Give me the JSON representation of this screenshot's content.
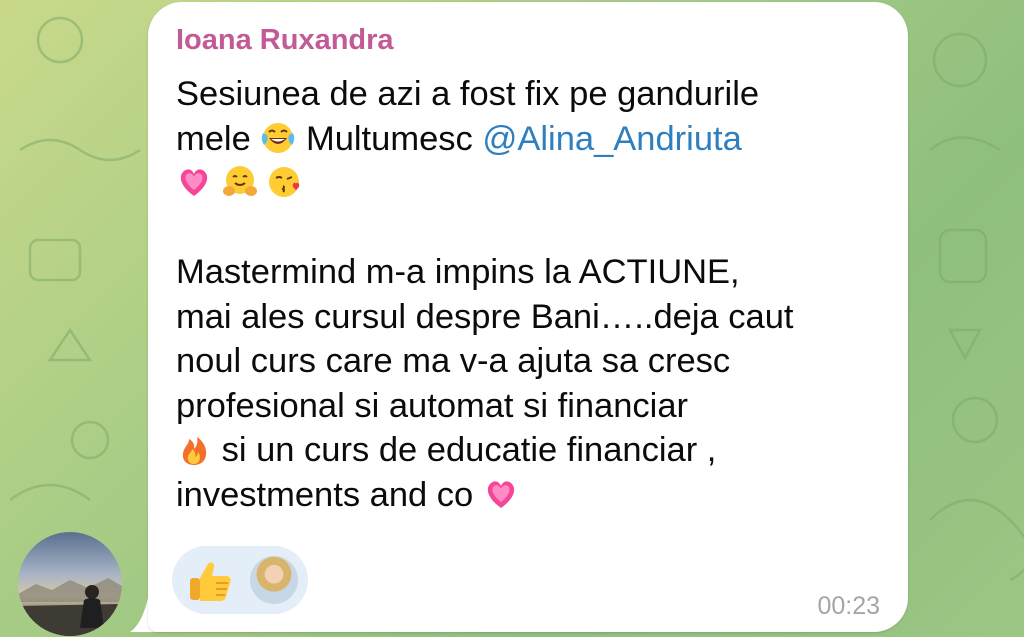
{
  "chat": {
    "sender_name": "Ioana Ruxandra",
    "message": {
      "line1": "Sesiunea de azi a fost fix pe gandurile",
      "line2_prefix": "mele",
      "line2_middle": "Multumesc",
      "line2_mention": "@Alina_Andriuta",
      "line5": "Mastermind m-a impins la ACTIUNE,",
      "line6": "mai ales cursul despre Bani…..deja caut",
      "line7": "noul curs care ma v-a ajuta sa cresc",
      "line8": "profesional si automat si financiar",
      "line9": "si un curs de educatie financiar ,",
      "line10": "investments and co"
    },
    "emojis": {
      "laughing": "face-with-tears-of-joy-icon",
      "heart": "growing-heart-icon",
      "hug": "hugging-face-icon",
      "kiss": "face-blowing-kiss-icon",
      "fire": "fire-icon"
    },
    "reaction": {
      "emoji": "thumbs-up-icon",
      "reactor": "reactor-avatar"
    },
    "timestamp": "00:23"
  },
  "colors": {
    "sender": "#c25a96",
    "mention": "#2f7fbf",
    "bubble": "#ffffff",
    "reaction_pill": "#e4eef8",
    "timestamp": "#a5a5a5"
  }
}
